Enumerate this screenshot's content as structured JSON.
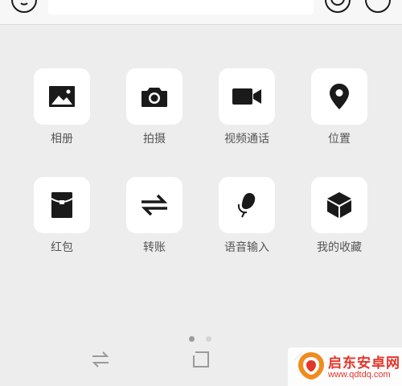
{
  "input_bar": {
    "left_button_icon": "voice-icon",
    "right_button_icons": [
      "emoji-icon",
      "plus-icon"
    ],
    "text_value": ""
  },
  "panel": {
    "tiles": [
      {
        "label": "相册",
        "icon": "image-icon"
      },
      {
        "label": "拍摄",
        "icon": "camera-icon"
      },
      {
        "label": "视频通话",
        "icon": "video-camera-icon"
      },
      {
        "label": "位置",
        "icon": "location-pin-icon"
      },
      {
        "label": "红包",
        "icon": "red-packet-icon"
      },
      {
        "label": "转账",
        "icon": "transfer-icon"
      },
      {
        "label": "语音输入",
        "icon": "microphone-icon"
      },
      {
        "label": "我的收藏",
        "icon": "cube-icon"
      }
    ],
    "page_indicator": {
      "pages": 2,
      "current": 1
    }
  },
  "navbar": {
    "icons": [
      "switch-arrows-icon",
      "square-icon",
      "back-icon"
    ]
  },
  "watermark": {
    "title": "启东安卓网",
    "url": "www.qdtdq.com"
  },
  "colors": {
    "background": "#ededed",
    "tile": "#ffffff",
    "icon": "#1a1a1a",
    "label": "#555555",
    "dot_active": "#9b9b9b",
    "dot_inactive": "#d4d4d4",
    "watermark": "#e4352a"
  }
}
